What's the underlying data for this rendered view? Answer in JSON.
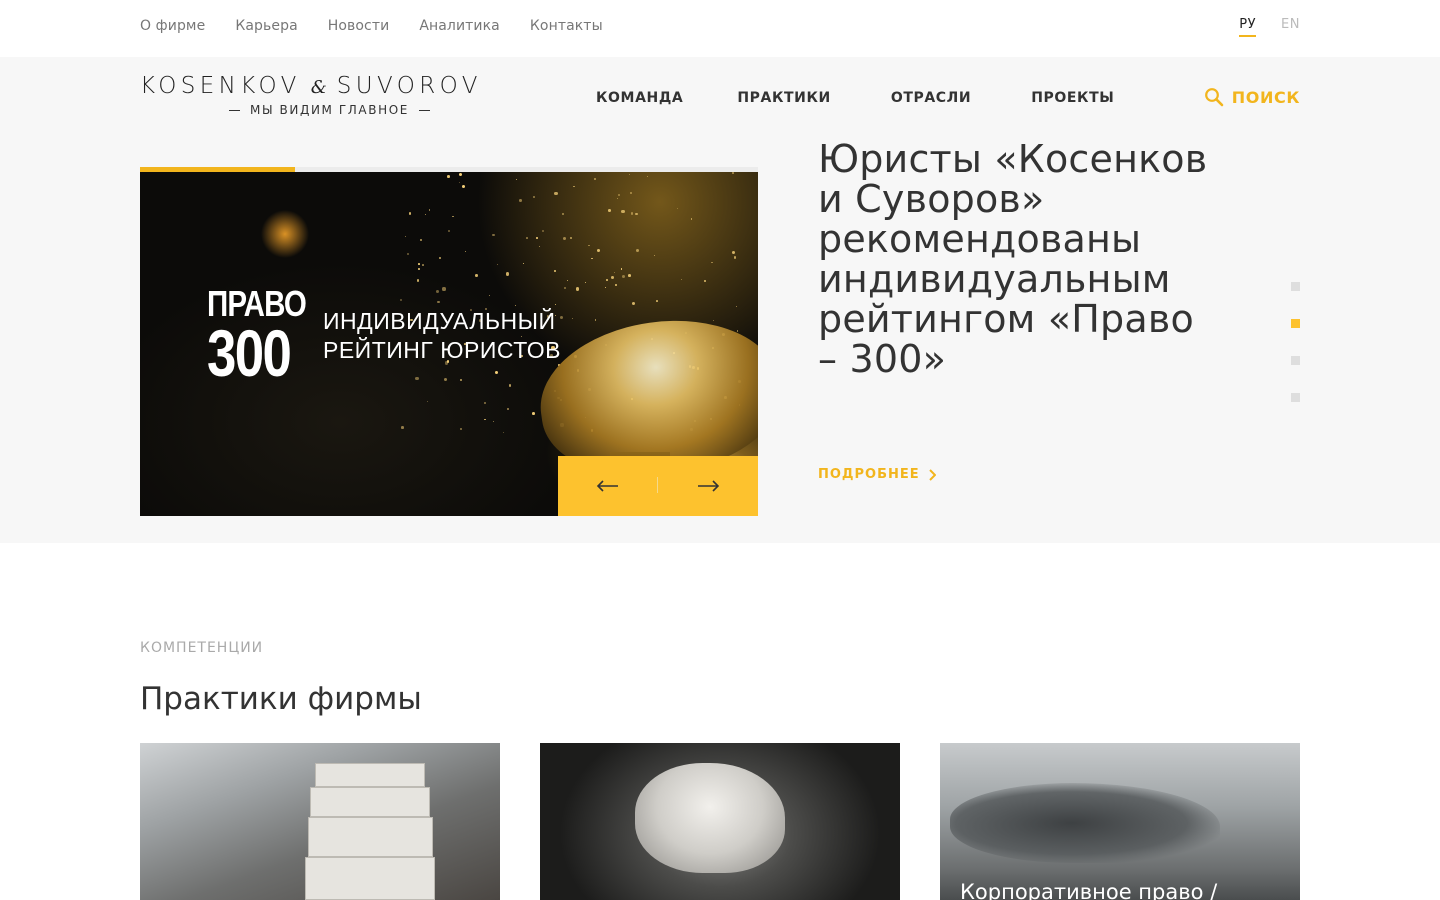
{
  "top_nav": {
    "links": [
      "О фирме",
      "Карьера",
      "Новости",
      "Аналитика",
      "Контакты"
    ],
    "lang_ru": "РУ",
    "lang_en": "EN"
  },
  "logo": {
    "left": "KOSENKOV",
    "amp": "&",
    "right": "SUVOROV",
    "tagline": "МЫ ВИДИМ ГЛАВНОЕ"
  },
  "main_nav": {
    "items": [
      "КОМАНДА",
      "ПРАКТИКИ",
      "ОТРАСЛИ",
      "ПРОЕКТЫ"
    ],
    "search_label": "ПОИСК"
  },
  "slider": {
    "progress": 0.25,
    "slide_brand_word": "ПРАВО",
    "slide_brand_number": "300",
    "slide_caption_line1": "ИНДИВИДУАЛЬНЫЙ",
    "slide_caption_line2": "РЕЙТИНГ ЮРИСТОВ",
    "prev_icon": "arrow-left",
    "next_icon": "arrow-right",
    "title": "Юристы «Косенков и Суворов» рекомендованы индивидуальным рейтингом «Право – 300»",
    "more_label": "ПОДРОБНЕЕ",
    "dots_total": 4,
    "dots_active_index": 1
  },
  "practices": {
    "label": "КОМПЕТЕНЦИИ",
    "title": "Практики фирмы",
    "cards": [
      {
        "title": ""
      },
      {
        "title": ""
      },
      {
        "title": "Корпоративное право /"
      }
    ]
  },
  "colors": {
    "accent": "#fdc22e",
    "accent_text": "#f2b51d",
    "hero_bg": "#f7f7f7",
    "text": "#333333"
  }
}
